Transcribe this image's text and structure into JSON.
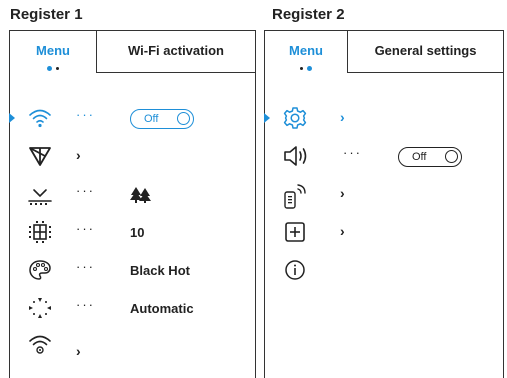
{
  "register1": {
    "title": "Register 1",
    "tabs": [
      {
        "label": "Menu"
      },
      {
        "label": "Wi-Fi activation"
      }
    ],
    "rows": [
      {
        "icon": "wifi-icon",
        "toggle": "Off",
        "selected": true
      },
      {
        "icon": "antenna-icon"
      },
      {
        "icon": "terrain-icon",
        "value_icon": "trees-icon"
      },
      {
        "icon": "grid-density-icon",
        "value": "10"
      },
      {
        "icon": "palette-icon",
        "value": "Black Hot"
      },
      {
        "icon": "calibration-icon",
        "value": "Automatic"
      },
      {
        "icon": "wifi-settings-icon"
      }
    ]
  },
  "register2": {
    "title": "Register 2",
    "tabs": [
      {
        "label": "Menu"
      },
      {
        "label": "General settings"
      }
    ],
    "rows": [
      {
        "icon": "gear-icon",
        "selected": true
      },
      {
        "icon": "speaker-icon",
        "toggle": "Off"
      },
      {
        "icon": "remote-icon"
      },
      {
        "icon": "plus-box-icon"
      },
      {
        "icon": "info-icon"
      }
    ]
  },
  "symbols": {
    "chevron": "›",
    "ellipsis": "···"
  },
  "colors": {
    "accent": "#1e8fd8",
    "text": "#222222"
  }
}
